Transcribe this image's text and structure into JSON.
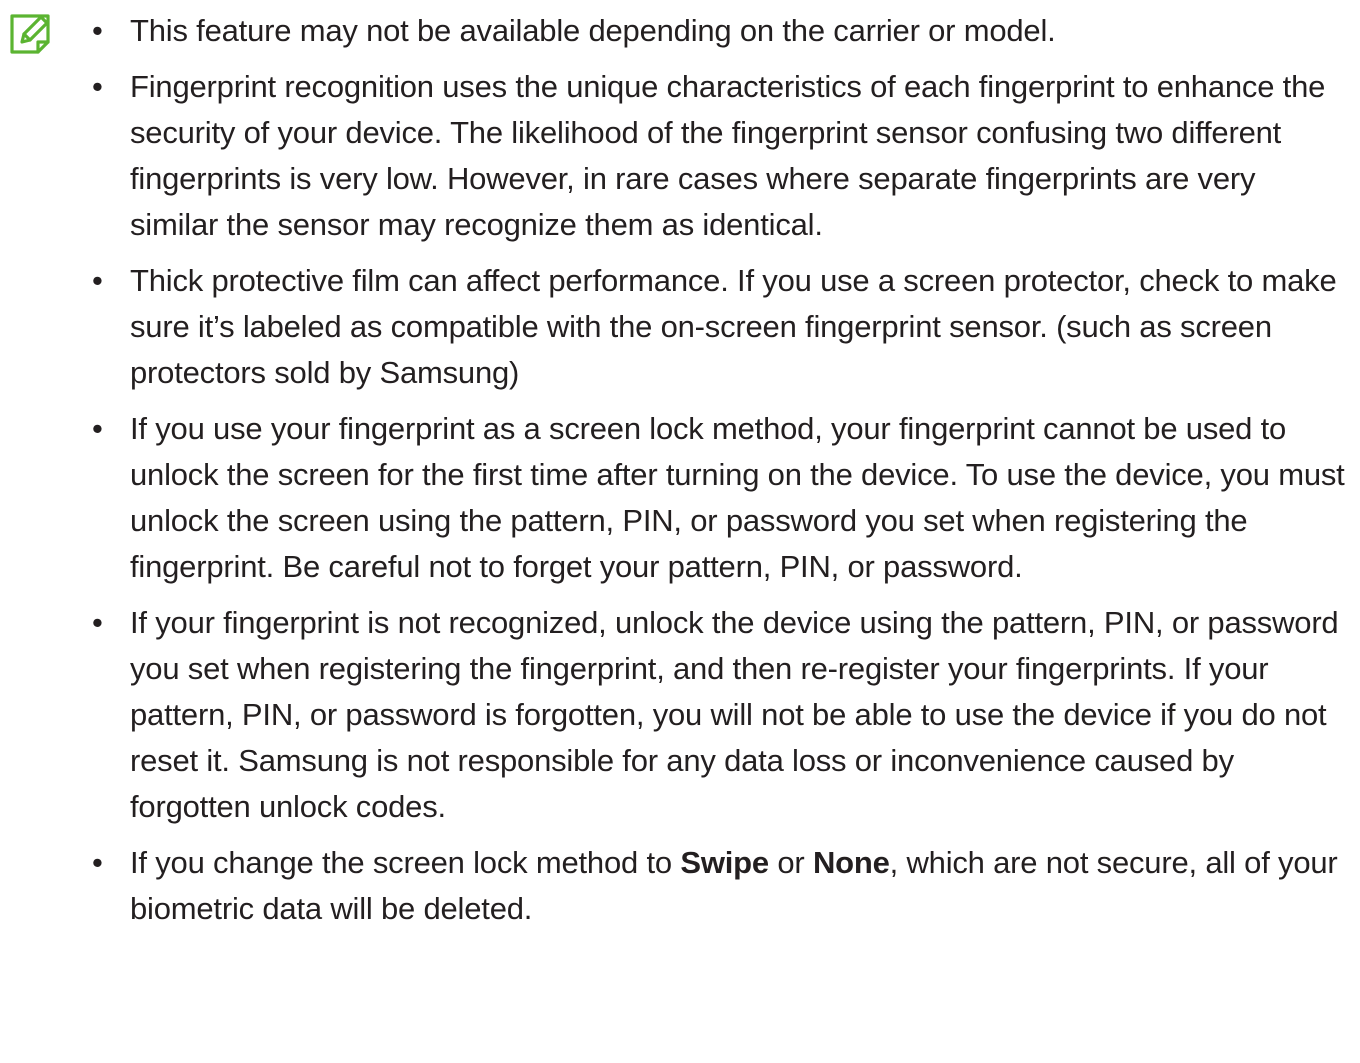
{
  "icon": {
    "name": "note-pencil-icon",
    "color": "#5bb431"
  },
  "notes": [
    {
      "parts": [
        "This feature may not be available depending on the carrier or model."
      ]
    },
    {
      "parts": [
        "Fingerprint recognition uses the unique characteristics of each fingerprint to enhance the security of your device. The likelihood of the fingerprint sensor confusing two different fingerprints is very low. However, in rare cases where separate fingerprints are very similar the sensor may recognize them as identical."
      ]
    },
    {
      "parts": [
        "Thick protective film can affect performance. If you use a screen protector, check to make sure it’s labeled as compatible with the on-screen fingerprint sensor. (such as screen protectors sold by Samsung)"
      ]
    },
    {
      "parts": [
        "If you use your fingerprint as a screen lock method, your fingerprint cannot be used to unlock the screen for the first time after turning on the device. To use the device, you must unlock the screen using the pattern, PIN, or password you set when registering the fingerprint. Be careful not to forget your pattern, PIN, or password."
      ]
    },
    {
      "parts": [
        "If your fingerprint is not recognized, unlock the device using the pattern, PIN, or password you set when registering the fingerprint, and then re-register your fingerprints. If your pattern, PIN, or password is forgotten, you will not be able to use the device if you do not reset it. Samsung is not responsible for any data loss or inconvenience caused by forgotten unlock codes."
      ]
    },
    {
      "parts": [
        "If you change the screen lock method to ",
        "Swipe",
        " or ",
        "None",
        ", which are not secure, all of your biometric data will be deleted."
      ]
    }
  ]
}
